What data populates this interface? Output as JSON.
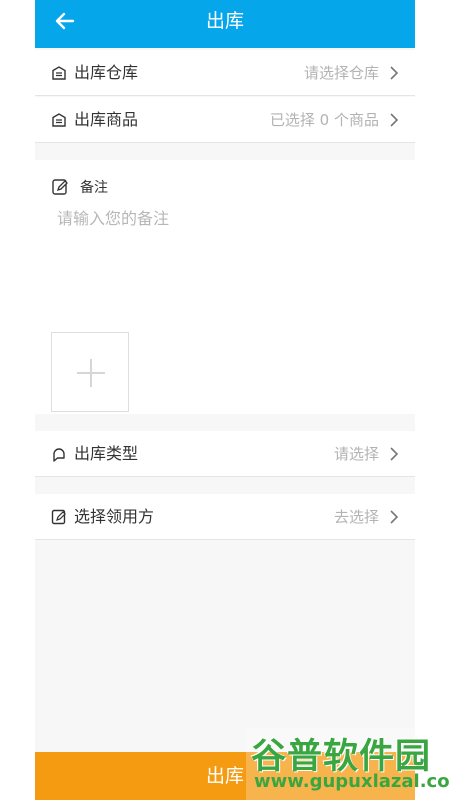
{
  "header": {
    "title": "出库",
    "back_icon": "arrow-left-icon"
  },
  "rows": [
    {
      "label": "出库仓库",
      "value": "请选择仓库",
      "icon": "warehouse-icon"
    },
    {
      "label": "出库商品",
      "value": "已选择 0 个商品",
      "icon": "warehouse-icon"
    },
    {
      "label": "出库类型",
      "value": "请选择",
      "icon": "hand-icon"
    },
    {
      "label": "选择领用方",
      "value": "去选择",
      "icon": "edit-icon"
    }
  ],
  "note": {
    "label": "备注",
    "placeholder": "请输入您的备注"
  },
  "bottom": {
    "button_label": "出库"
  },
  "watermark": {
    "brand": "谷普软件园",
    "url": "www.gupuxlazal.com"
  },
  "colors": {
    "header": "#06a7ea",
    "button": "#f59b12",
    "watermark": "#3aa641"
  }
}
